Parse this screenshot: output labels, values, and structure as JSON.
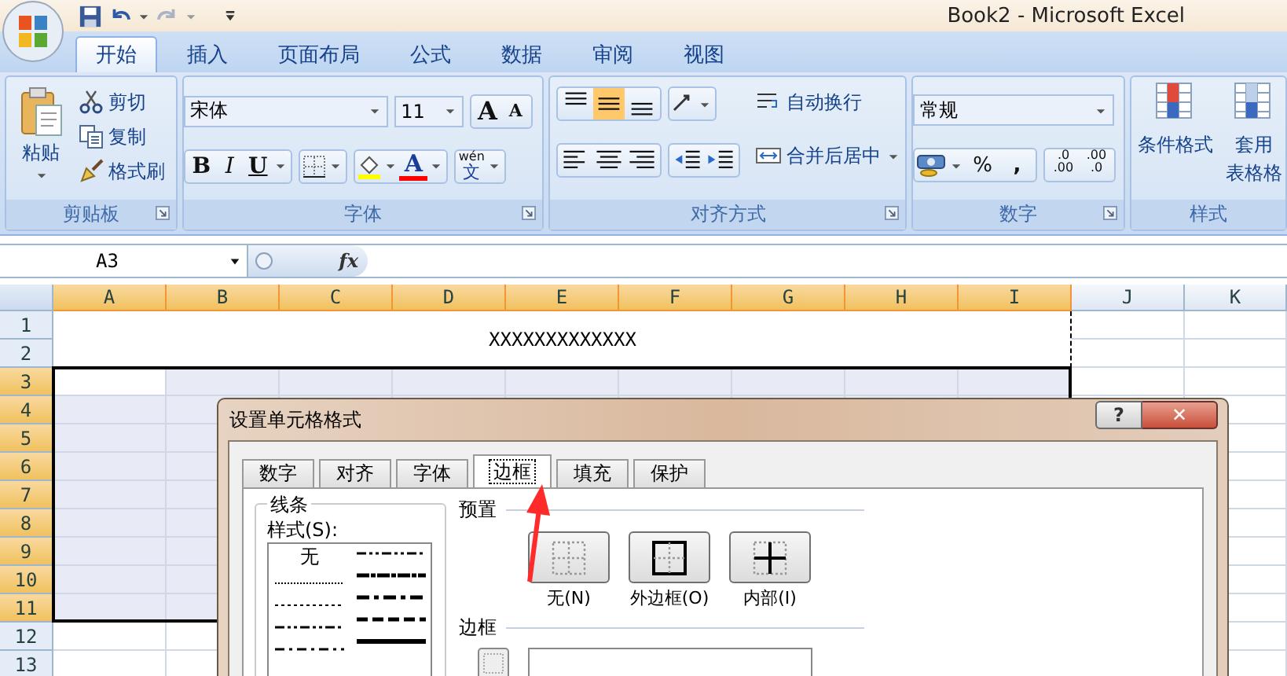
{
  "window": {
    "title": "Book2 - Microsoft Excel"
  },
  "tabs": [
    {
      "label": "开始",
      "selected": true
    },
    {
      "label": "插入",
      "selected": false
    },
    {
      "label": "页面布局",
      "selected": false
    },
    {
      "label": "公式",
      "selected": false
    },
    {
      "label": "数据",
      "selected": false
    },
    {
      "label": "审阅",
      "selected": false
    },
    {
      "label": "视图",
      "selected": false
    }
  ],
  "clipboard": {
    "title": "剪贴板",
    "paste": "粘贴",
    "items": [
      {
        "label": "剪切",
        "kind": "cut"
      },
      {
        "label": "复制",
        "kind": "copy"
      },
      {
        "label": "格式刷",
        "kind": "painter"
      }
    ]
  },
  "font": {
    "title": "字体",
    "name": "宋体",
    "size": "11",
    "grow": "A",
    "shrink": "A",
    "styles": [
      {
        "label": "B",
        "kind": "bold"
      },
      {
        "label": "I",
        "kind": "italic"
      },
      {
        "label": "U",
        "kind": "underline"
      }
    ],
    "color_letter": "A",
    "phonetic_top": "wén",
    "phonetic_bottom": "文"
  },
  "alignment": {
    "title": "对齐方式",
    "vertical": [
      {
        "kind": "top",
        "selected": false
      },
      {
        "kind": "middle",
        "selected": true
      },
      {
        "kind": "bottom",
        "selected": false
      }
    ],
    "horizontal": [
      {
        "kind": "left",
        "selected": false
      },
      {
        "kind": "center",
        "selected": false
      },
      {
        "kind": "right",
        "selected": false
      }
    ],
    "wrap": "自动换行",
    "merge": "合并后居中"
  },
  "number": {
    "title": "数字",
    "format": "常规",
    "percent": "%",
    "comma": ",",
    "decimals": [
      {
        "top": ".0",
        "bottom": ".00"
      },
      {
        "top": ".00",
        "bottom": ".0"
      }
    ]
  },
  "styles": {
    "title": "样式",
    "buttons": [
      {
        "lines": [
          "条件格式"
        ]
      },
      {
        "lines": [
          "套用",
          "表格格"
        ]
      }
    ]
  },
  "formula_bar": {
    "name_box": "A3",
    "fx": "fx"
  },
  "sheet": {
    "columns": [
      {
        "label": "A",
        "selected": true
      },
      {
        "label": "B",
        "selected": true
      },
      {
        "label": "C",
        "selected": true
      },
      {
        "label": "D",
        "selected": true
      },
      {
        "label": "E",
        "selected": true
      },
      {
        "label": "F",
        "selected": true
      },
      {
        "label": "G",
        "selected": true
      },
      {
        "label": "H",
        "selected": true
      },
      {
        "label": "I",
        "selected": true
      },
      {
        "label": "J",
        "selected": false
      },
      {
        "label": "K",
        "selected": false
      }
    ],
    "rows": [
      {
        "label": "1",
        "selected": false
      },
      {
        "label": "2",
        "selected": false
      },
      {
        "label": "3",
        "selected": true
      },
      {
        "label": "4",
        "selected": true
      },
      {
        "label": "5",
        "selected": true
      },
      {
        "label": "6",
        "selected": true
      },
      {
        "label": "7",
        "selected": true
      },
      {
        "label": "8",
        "selected": true
      },
      {
        "label": "9",
        "selected": true
      },
      {
        "label": "10",
        "selected": true
      },
      {
        "label": "11",
        "selected": true
      },
      {
        "label": "12",
        "selected": false
      },
      {
        "label": "13",
        "selected": false
      }
    ],
    "title": "XXXXXXXXXXXXX"
  },
  "dialog": {
    "title": "设置单元格格式",
    "help": "?",
    "close": "✕",
    "tabs": [
      {
        "label": "数字",
        "selected": false
      },
      {
        "label": "对齐",
        "selected": false
      },
      {
        "label": "字体",
        "selected": false
      },
      {
        "label": "边框",
        "selected": true
      },
      {
        "label": "填充",
        "selected": false
      },
      {
        "label": "保护",
        "selected": false
      }
    ],
    "line_group": "线条",
    "style_label": "样式(S):",
    "line_styles": [
      {
        "kind": "none",
        "label": "无"
      },
      {
        "kind": "hair"
      },
      {
        "kind": "dotted"
      },
      {
        "kind": "dashdotdot"
      },
      {
        "kind": "dashdot"
      },
      {
        "kind": "dashdotdot"
      },
      {
        "kind": "slanted"
      },
      {
        "kind": "mediumdashdot"
      },
      {
        "kind": "mediumdashed"
      },
      {
        "kind": "thick"
      }
    ],
    "preset_label": "预置",
    "presets": [
      {
        "label": "无(N)",
        "kind": "none"
      },
      {
        "label": "外边框(O)",
        "kind": "outline"
      },
      {
        "label": "内部(I)",
        "kind": "inside"
      }
    ],
    "border_label": "边框"
  }
}
